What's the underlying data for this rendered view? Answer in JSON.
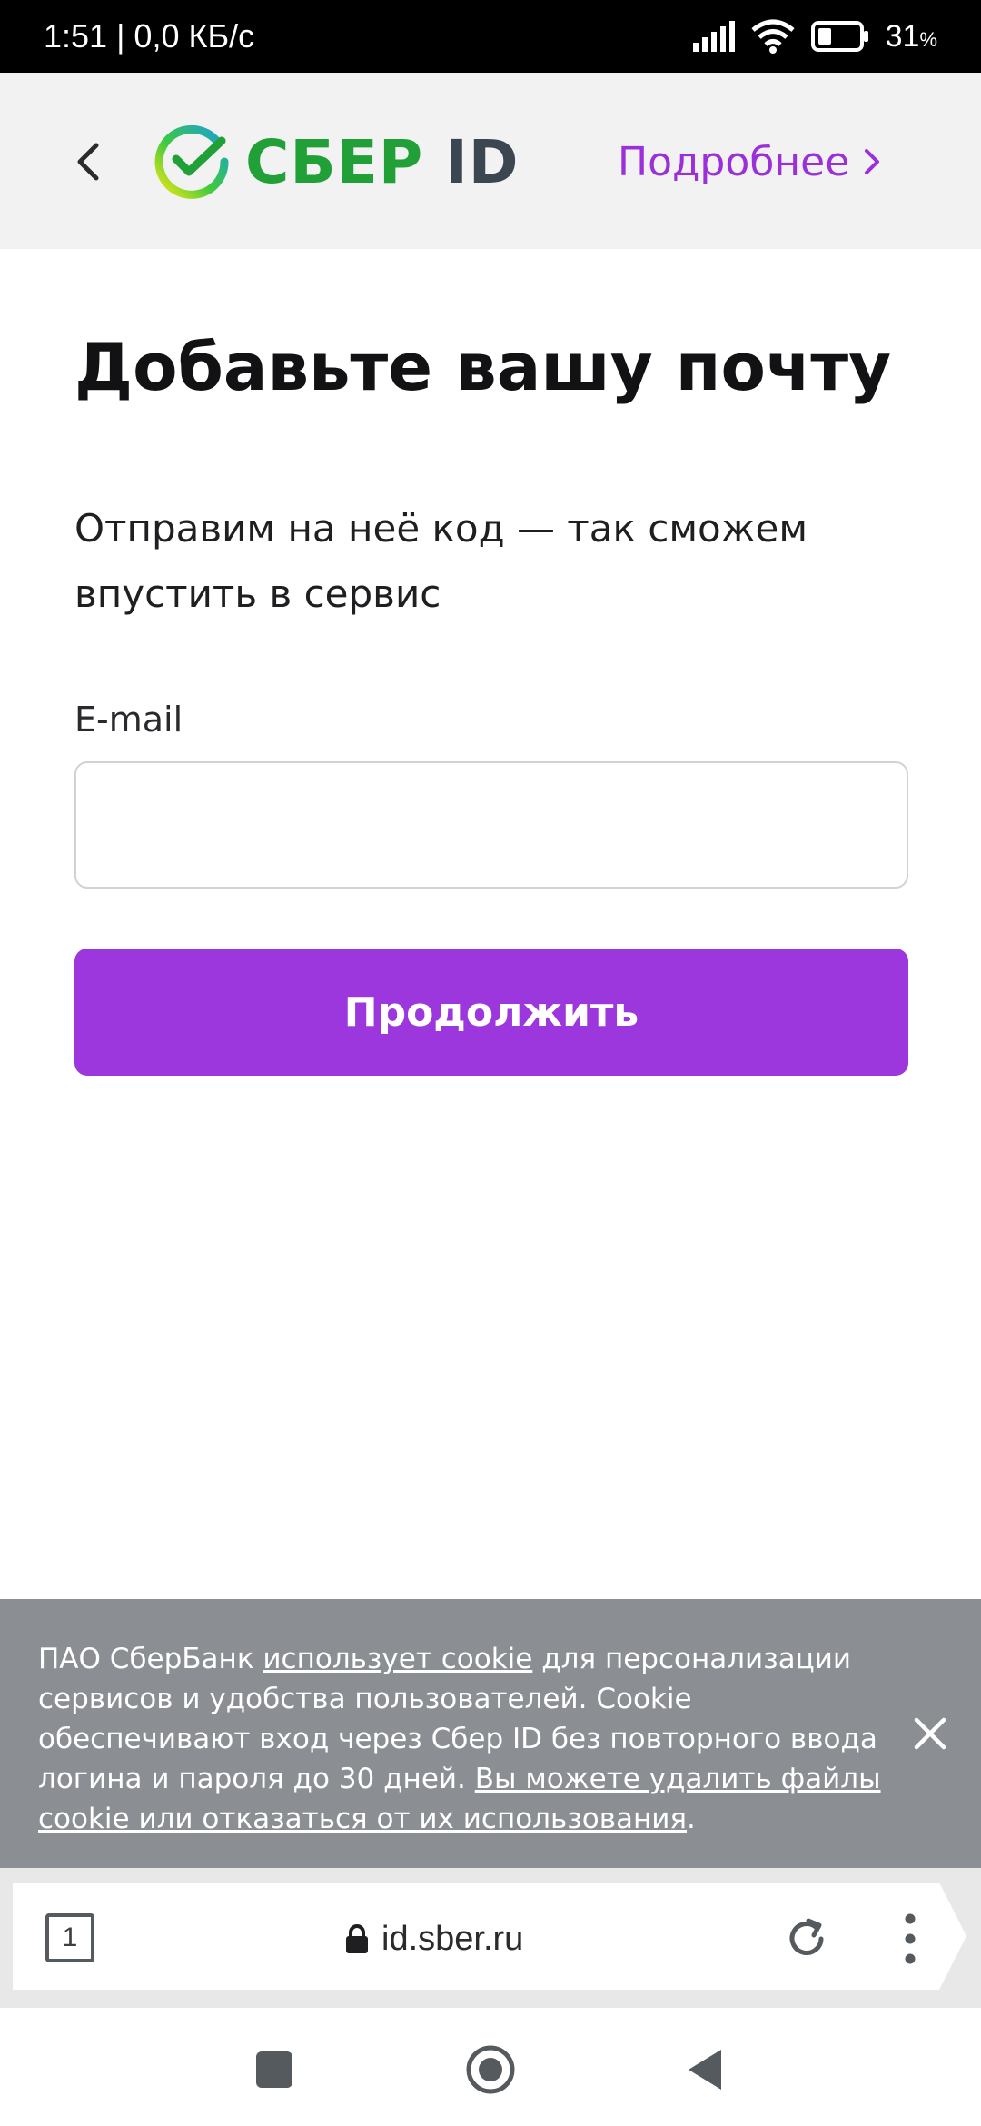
{
  "status_bar": {
    "time_speed": "1:51 | 0,0 КБ/с",
    "battery": "31",
    "battery_unit": "%"
  },
  "header": {
    "logo_main": "СБЕР",
    "logo_suffix": "ID",
    "more_link": "Подробнее",
    "brand_green": "#21a038",
    "link_color": "#9b30d9"
  },
  "main": {
    "title": "Добавьте вашу почту",
    "subtitle": "Отправим на неё код — так сможем впустить в сервис",
    "email_label": "E-mail",
    "email_value": "",
    "continue_label": "Продолжить",
    "button_color": "#9b37dd"
  },
  "cookie_banner": {
    "text_1": "ПАО СберБанк ",
    "link_1": "использует cookie",
    "text_2": " для персонализации сервисов и удобства пользователей. Cookie обеспечивают вход через Сбер ID без повторного ввода логина и пароля до 30 дней. ",
    "link_2": "Вы можете удалить файлы cookie или отказаться от их использования",
    "text_3": ".",
    "background": "#8b8f93"
  },
  "browser": {
    "tab_count": "1",
    "url": "id.sber.ru"
  },
  "icons": {
    "status": [
      "signal-icon",
      "wifi-icon",
      "battery-icon"
    ],
    "header": [
      "back-icon",
      "sber-logo-icon",
      "chevron-right-icon"
    ],
    "browser": [
      "lock-icon",
      "reload-icon",
      "more-vert-icon"
    ],
    "nav": [
      "recents-icon",
      "home-icon",
      "back-triangle-icon"
    ]
  }
}
